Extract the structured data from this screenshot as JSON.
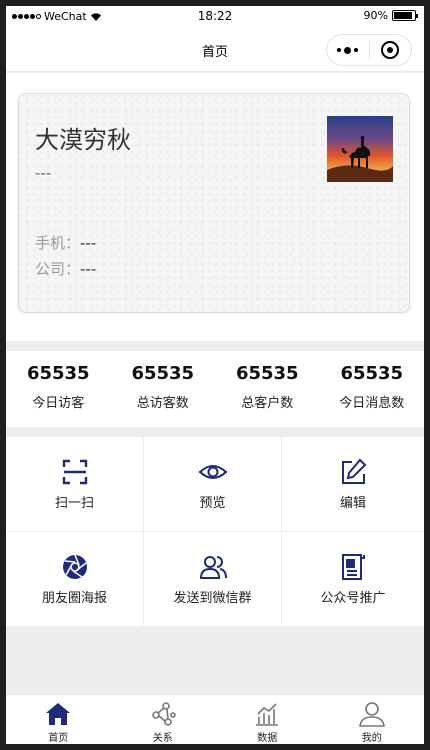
{
  "status_bar": {
    "carrier": "WeChat",
    "time": "18:22",
    "battery": "90%",
    "battery_level": 0.9
  },
  "nav": {
    "title": "首页"
  },
  "card": {
    "name": "大漠穷秋",
    "title": "---",
    "phone_label": "手机：",
    "phone_value": "---",
    "company_label": "公司：",
    "company_value": "---"
  },
  "stats": [
    {
      "value": "65535",
      "label": "今日访客"
    },
    {
      "value": "65535",
      "label": "总访客数"
    },
    {
      "value": "65535",
      "label": "总客户数"
    },
    {
      "value": "65535",
      "label": "今日消息数"
    }
  ],
  "actions": [
    {
      "label": "扫一扫",
      "icon": "scan-icon"
    },
    {
      "label": "预览",
      "icon": "eye-icon"
    },
    {
      "label": "编辑",
      "icon": "edit-icon"
    },
    {
      "label": "朋友圈海报",
      "icon": "aperture-icon"
    },
    {
      "label": "发送到微信群",
      "icon": "users-icon"
    },
    {
      "label": "公众号推广",
      "icon": "document-icon"
    }
  ],
  "tabs": [
    {
      "label": "首页",
      "icon": "home-icon",
      "active": true
    },
    {
      "label": "关系",
      "icon": "network-icon",
      "active": false
    },
    {
      "label": "数据",
      "icon": "chart-icon",
      "active": false
    },
    {
      "label": "我的",
      "icon": "profile-icon",
      "active": false
    }
  ],
  "colors": {
    "accent": "#1f2a7a",
    "background": "#ededed",
    "tab_inactive": "#777777"
  }
}
